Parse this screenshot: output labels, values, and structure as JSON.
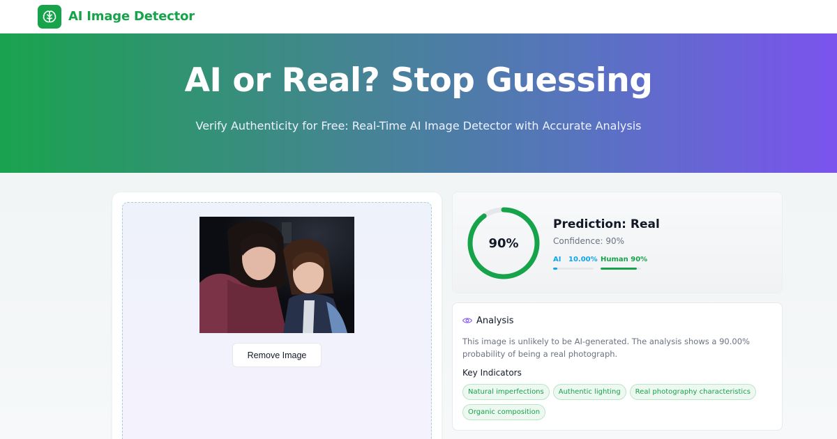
{
  "header": {
    "logo_icon": "brain-icon",
    "brand": "AI Image Detector",
    "brand_color": "#16a34a"
  },
  "hero": {
    "title": "AI or Real? Stop Guessing",
    "subtitle": "Verify Authenticity for Free: Real-Time AI Image Detector with Accurate Analysis",
    "gradient_start": "#1aa34e",
    "gradient_end": "#7b53ee"
  },
  "upload": {
    "image_description": "photo",
    "remove_label": "Remove Image"
  },
  "result": {
    "percent_label": "90%",
    "percent_value": 0.9,
    "prediction": "Prediction: Real",
    "confidence": "Confidence: 90%",
    "ai_label": "AI",
    "ai_value": "10.00%",
    "ai_fraction": 0.1,
    "human_label": "Human 90%",
    "human_fraction": 0.9,
    "ai_color": "#0ea5e9",
    "human_color": "#16a34a"
  },
  "analysis": {
    "icon": "eye-icon",
    "title": "Analysis",
    "text": "This image is unlikely to be AI-generated. The analysis shows a 90.00% probability of being a real photograph.",
    "key_title": "Key Indicators",
    "tags": [
      "Natural imperfections",
      "Authentic lighting",
      "Real photography characteristics",
      "Organic composition"
    ]
  }
}
